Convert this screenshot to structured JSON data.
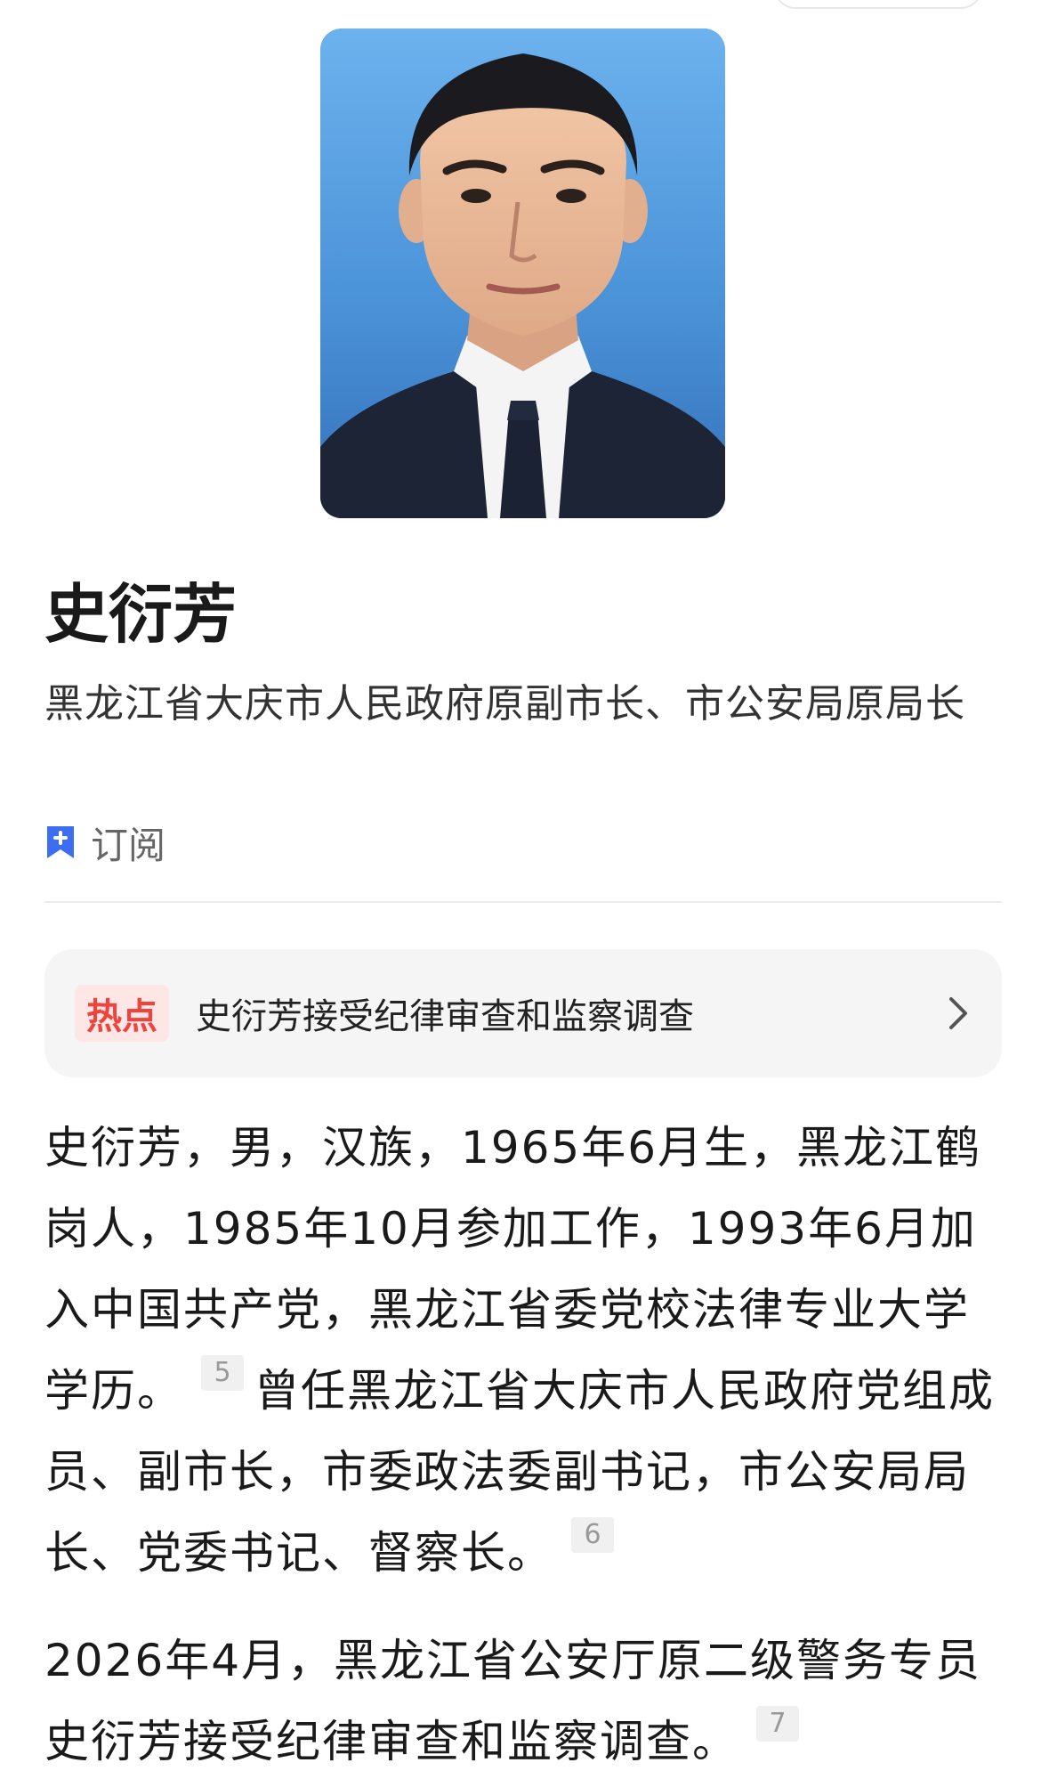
{
  "profile": {
    "name": "史衍芳",
    "title": "黑龙江省大庆市人民政府原副市长、市公安局原局长",
    "subscribe_label": "订阅"
  },
  "hot": {
    "badge": "热点",
    "text": "史衍芳接受纪律审查和监察调查"
  },
  "body": {
    "p1_text_a": "史衍芳，男，汉族，1965年6月生，黑龙江鹤岗人，1985年10月参加工作，1993年6月加入中国共产党，黑龙江省委党校法律专业大学学历。",
    "p1_cite_a": "5",
    "p1_text_b": "曾任黑龙江省大庆市人民政府党组成员、副市长，市委政法委副书记，市公安局局长、党委书记、督察长。",
    "p1_cite_b": "6",
    "p2_text": "2026年4月，黑龙江省公安厅原二级警务专员史衍芳接受纪律审查和监察调查。",
    "p2_cite": "7"
  },
  "colors": {
    "accent_blue": "#3d6df2",
    "hot_red": "#f0433b",
    "hot_bg": "#fde6e6"
  },
  "icons": {
    "subscribe": "bookmark-plus-icon",
    "arrow": "chevron-right-icon"
  }
}
